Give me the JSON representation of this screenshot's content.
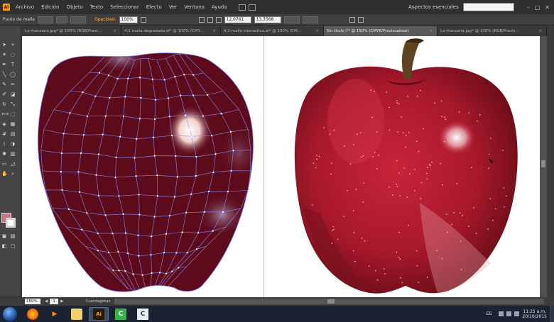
{
  "menubar": {
    "logo": "Ai",
    "items": [
      "Archivo",
      "Edición",
      "Objeto",
      "Texto",
      "Seleccionar",
      "Efecto",
      "Ver",
      "Ventana",
      "Ayuda"
    ],
    "workspace": "Aspectos esenciales",
    "window_controls": [
      "–",
      "□",
      "✕"
    ]
  },
  "controlbar": {
    "label": "Punto de malla",
    "opacity_label": "Opacidad:",
    "opacity_value": "100%",
    "x_value": "12,0761 cm",
    "y_value": "13,3568 cm"
  },
  "tabs": [
    {
      "label": "La-manzana.jpg* @ 100% (RGB/Previ...",
      "active": false
    },
    {
      "label": "4.1 malla degradado.ai* @ 100% (CMY...",
      "active": false
    },
    {
      "label": "4.2-malla interactiva.ai* @ 100% (CM...",
      "active": false
    },
    {
      "label": "Sin título-7* @ 150% (CMYK/Previsualizar)",
      "active": true
    },
    {
      "label": "La-manzana.jpg* @ 100% (RGB/Previs...",
      "active": false
    }
  ],
  "tab_close": "×",
  "statusbar": {
    "zoom": "150%",
    "page": "1",
    "status": "Cuentagotas",
    "prev": "◀",
    "next": "▶"
  },
  "taskbar": {
    "language": "ES",
    "time": "11:25 a.m.",
    "date": "20/10/2015",
    "apps": [
      {
        "name": "firefox",
        "glyph": "",
        "color": "#ff7b00"
      },
      {
        "name": "media-player",
        "glyph": "▶",
        "color": "#ff8c00"
      },
      {
        "name": "explorer",
        "glyph": "",
        "color": "#f1d06b"
      },
      {
        "name": "illustrator",
        "glyph": "Ai",
        "color": "#ff9a00"
      },
      {
        "name": "camtasia-green",
        "glyph": "C",
        "color": "#35b34a"
      },
      {
        "name": "camtasia-white",
        "glyph": "C",
        "color": "#2f3b4a"
      }
    ]
  },
  "colors": {
    "mesh_apple": "#5d0b1a",
    "mesh_lines": "#8c8cff",
    "fill_swatch": "#c9787f",
    "accent": "#ff9a00"
  }
}
